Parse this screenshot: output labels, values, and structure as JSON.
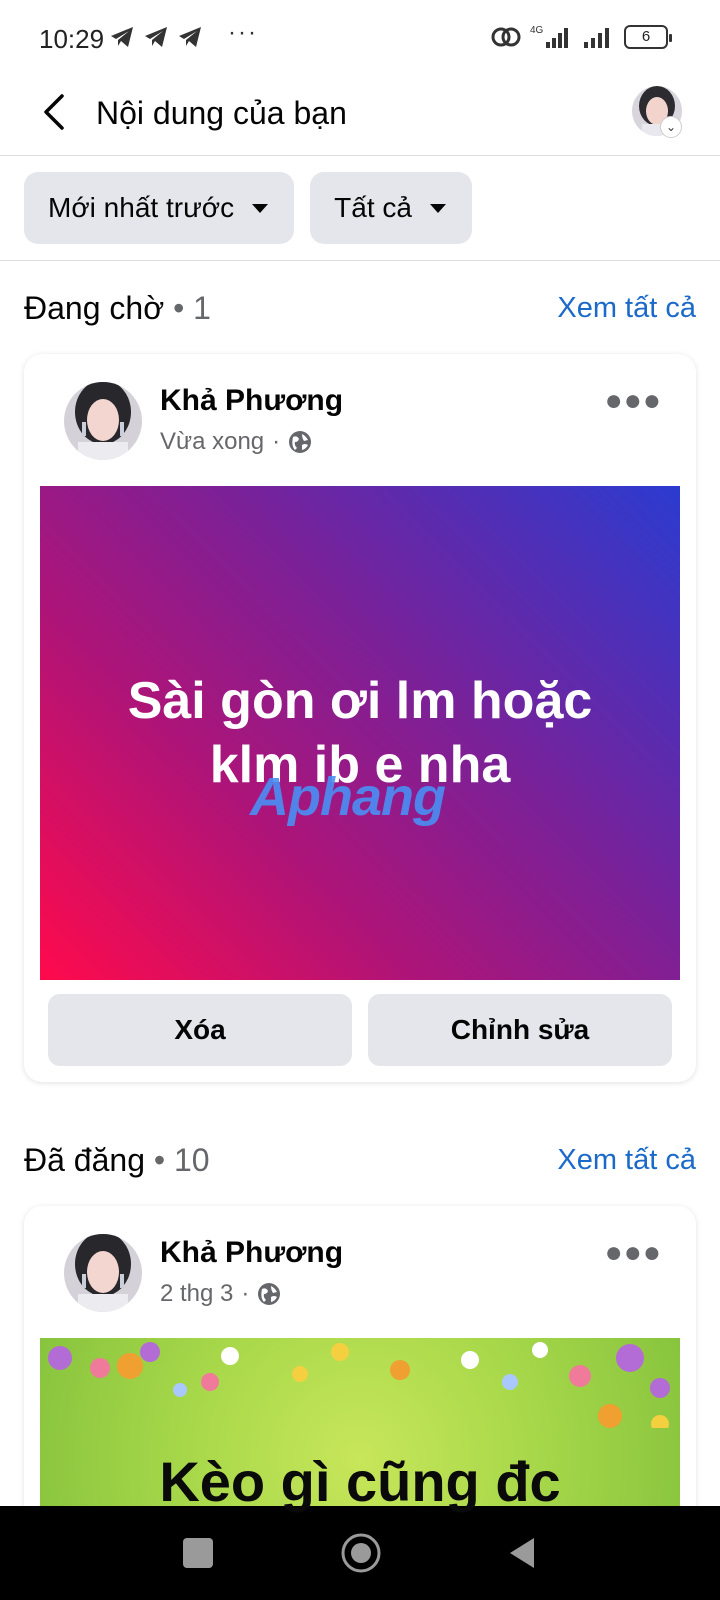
{
  "status_bar": {
    "time": "10:29",
    "dots": "···",
    "network": "4G",
    "battery": "6"
  },
  "header": {
    "title": "Nội dung của bạn"
  },
  "filters": [
    {
      "label": "Mới nhất trước"
    },
    {
      "label": "Tất cả"
    }
  ],
  "pending": {
    "title": "Đang chờ",
    "count": "• 1",
    "see_all": "Xem tất cả",
    "post": {
      "author": "Khả Phương",
      "time": "Vừa xong",
      "separator": "·",
      "text": "Sài gòn ơi lm hoặc klm ib e nha",
      "watermark": "Aphang",
      "delete_label": "Xóa",
      "edit_label": "Chỉnh sửa"
    }
  },
  "posted": {
    "title": "Đã đăng",
    "count": "• 10",
    "see_all": "Xem tất cả",
    "post": {
      "author": "Khả Phương",
      "time": "2 thg 3",
      "separator": "·",
      "text": "Kèo gì cũng đc"
    }
  },
  "colors": {
    "link": "#1b6ac9",
    "chip_bg": "#e4e6eb",
    "secondary_text": "#65676b"
  }
}
